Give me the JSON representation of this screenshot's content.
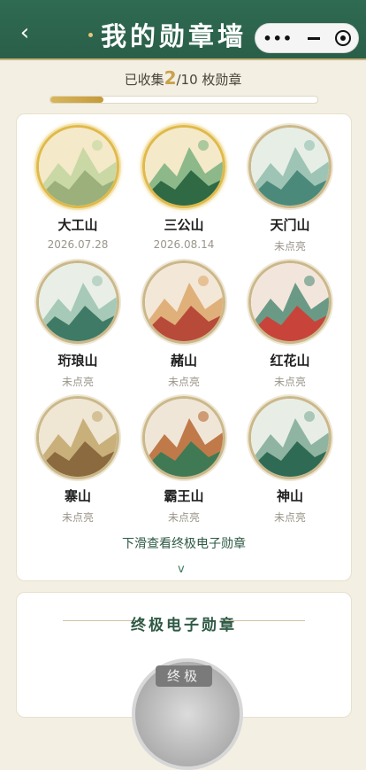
{
  "header": {
    "back_icon": "chevron-left-icon",
    "title": "我的勋章墙",
    "menu_icons": [
      "more-icon",
      "minimize-icon",
      "close-target-icon"
    ]
  },
  "summary": {
    "prefix": "已收集",
    "collected": "2",
    "total_text": "/10 枚勋章",
    "progress_fraction": 0.2
  },
  "badges": [
    {
      "name": "大工山",
      "status": "2026.07.28",
      "lit": true
    },
    {
      "name": "三公山",
      "status": "2026.08.14",
      "lit": true
    },
    {
      "name": "天门山",
      "status": "未点亮",
      "lit": false
    },
    {
      "name": "珩琅山",
      "status": "未点亮",
      "lit": false
    },
    {
      "name": "赭山",
      "status": "未点亮",
      "lit": false
    },
    {
      "name": "红花山",
      "status": "未点亮",
      "lit": false
    },
    {
      "name": "寨山",
      "status": "未点亮",
      "lit": false
    },
    {
      "name": "霸王山",
      "status": "未点亮",
      "lit": false
    },
    {
      "name": "神山",
      "status": "未点亮",
      "lit": false
    }
  ],
  "more_hint": "下滑查看终极电子勋章",
  "more_chevron": "v",
  "final_section": {
    "title": "终极电子勋章",
    "badge_label": "终极"
  }
}
